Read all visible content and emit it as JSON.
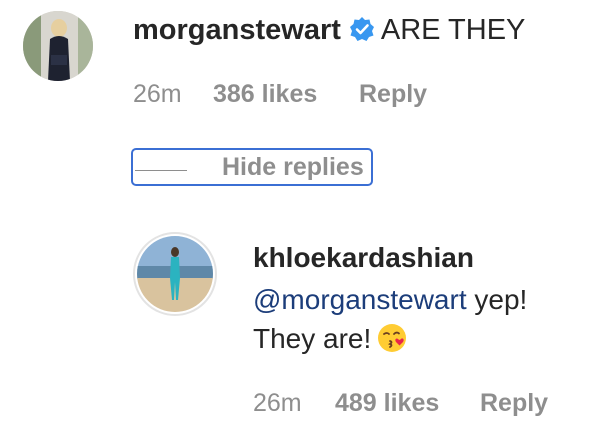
{
  "comment": {
    "username": "morganstewart",
    "text": "ARE THEY",
    "time": "26m",
    "likes": "386 likes",
    "reply_label": "Reply"
  },
  "hide_replies_label": "Hide replies",
  "reply": {
    "username": "khloekardashian",
    "mention": "@morganstewart",
    "text_line1_rest": " yep!",
    "text_line2": "They are!",
    "emoji": "kissing-face-with-heart-emoji",
    "time": "26m",
    "likes": "489 likes",
    "reply_label": "Reply"
  },
  "colors": {
    "text": "#262626",
    "meta_gray": "#8e8e8e",
    "verified_blue": "#3897f0",
    "mention_blue": "#1c3d7a",
    "focus_border": "#3b6fd4"
  }
}
